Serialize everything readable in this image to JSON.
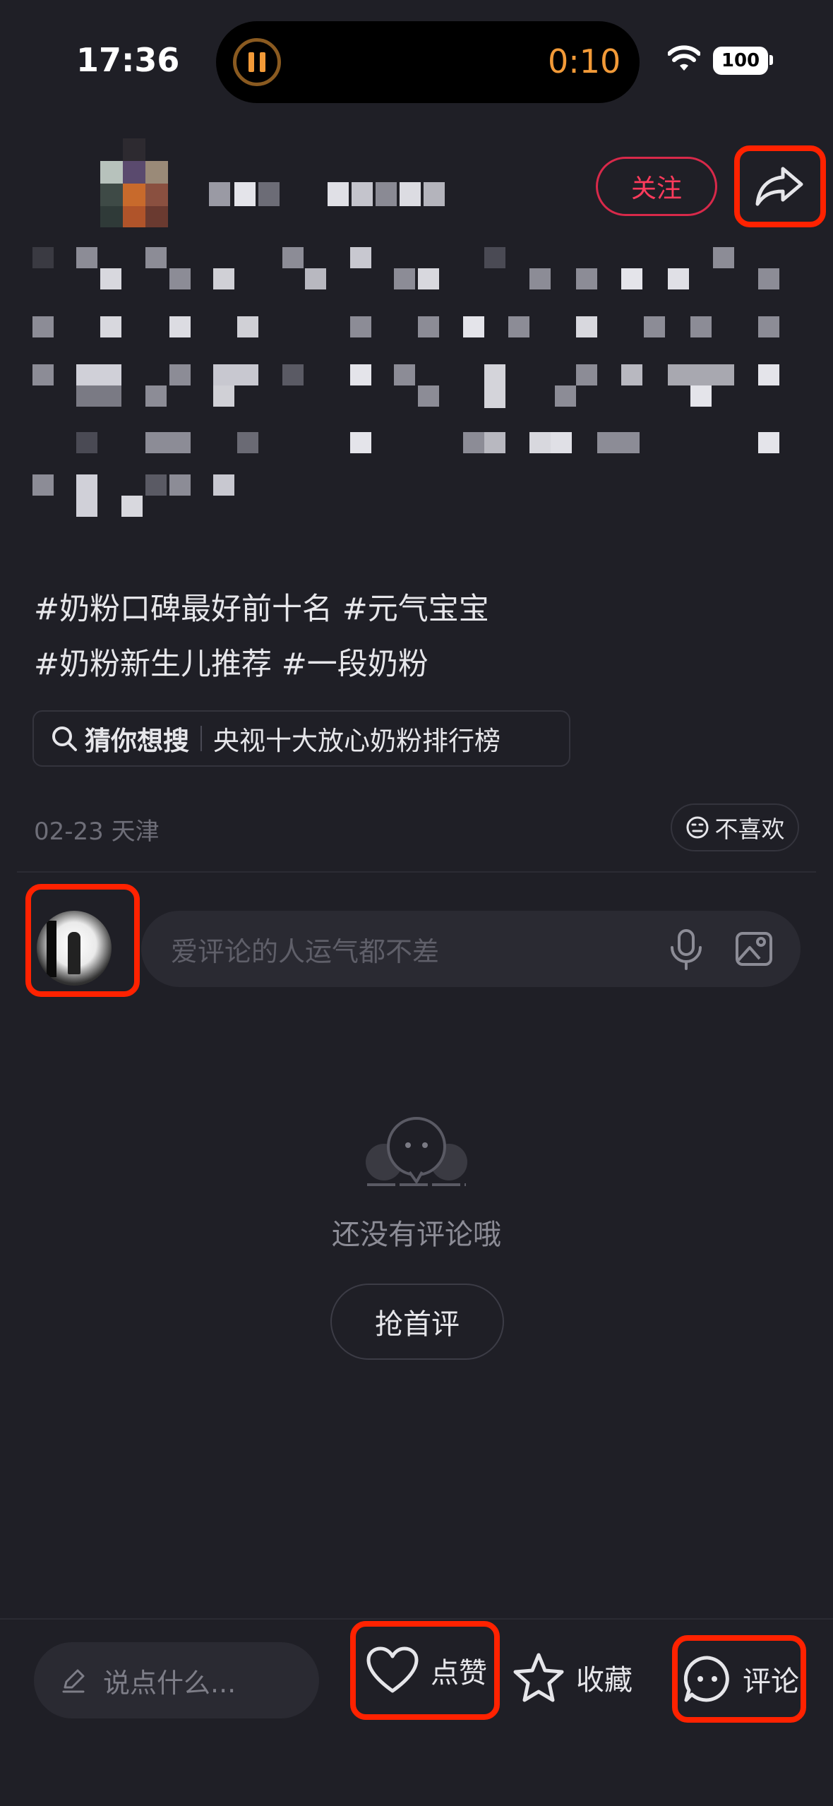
{
  "status_bar": {
    "time": "17:36",
    "media_timer": "0:10",
    "battery": "100"
  },
  "header": {
    "follow_label": "关注",
    "share_icon": "share-arrow-icon"
  },
  "post": {
    "hashtags_line1": "#奶粉口碑最好前十名 #元气宝宝",
    "hashtags_line2": "#奶粉新生儿推荐 #一段奶粉",
    "guess_label": "猜你想搜",
    "guess_query": "央视十大放心奶粉排行榜",
    "date_location": "02-23 天津",
    "dislike_label": "不喜欢"
  },
  "comment_box": {
    "placeholder": "爱评论的人运气都不差"
  },
  "empty_state": {
    "message": "还没有评论哦",
    "first_comment_label": "抢首评"
  },
  "bottom_bar": {
    "say_placeholder": "说点什么...",
    "like_label": "点赞",
    "favorite_label": "收藏",
    "comment_label": "评论"
  },
  "colors": {
    "background": "#1f1f26",
    "accent": "#ff3b5c",
    "highlight": "#ff2200",
    "timer": "#f29a38"
  }
}
